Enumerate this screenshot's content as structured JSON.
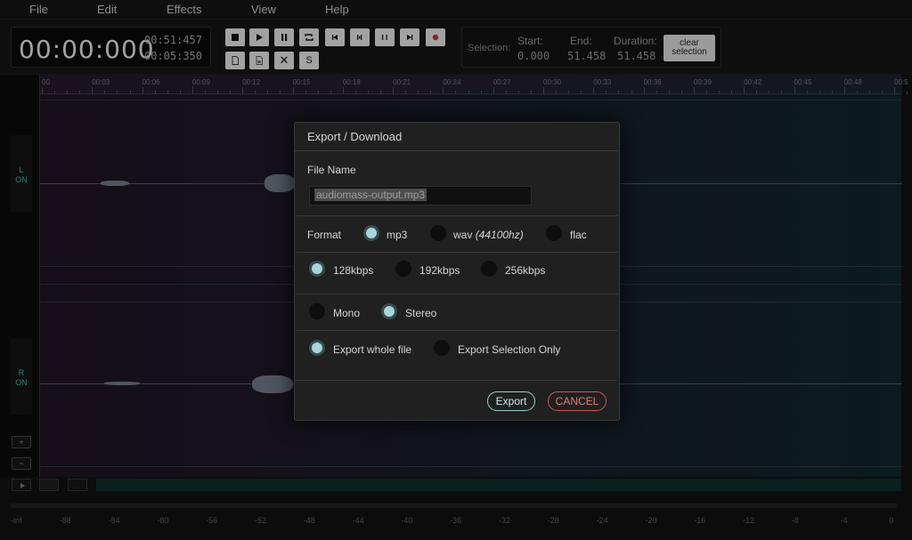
{
  "menu": {
    "file": "File",
    "edit": "Edit",
    "effects": "Effects",
    "view": "View",
    "help": "Help"
  },
  "time": {
    "main": "00:00:000",
    "total": "00:51:457",
    "sub": "00:05:350"
  },
  "selection": {
    "label": "Selection:",
    "start_label": "Start:",
    "start_value": "0.000",
    "end_label": "End:",
    "end_value": "51.458",
    "duration_label": "Duration:",
    "duration_value": "51.458",
    "clear_line1": "clear",
    "clear_line2": "selection"
  },
  "toolbar_extra": {
    "cut_glyph": "✕",
    "s_glyph": "S"
  },
  "timeline_ticks": [
    "00",
    "00:03",
    "00:06",
    "00:09",
    "00:12",
    "00:15",
    "00:18",
    "00:21",
    "00:24",
    "00:27",
    "00:30",
    "00:33",
    "00:36",
    "00:39",
    "00:42",
    "00:45",
    "00:48",
    "00:5"
  ],
  "channels": {
    "left": {
      "letter": "L",
      "state": "ON"
    },
    "right": {
      "letter": "R",
      "state": "ON"
    }
  },
  "meter_labels": [
    "-inf",
    "-88",
    "-84",
    "-80",
    "-56",
    "-52",
    "-48",
    "-44",
    "-40",
    "-36",
    "-32",
    "-28",
    "-24",
    "-20",
    "-16",
    "-12",
    "-8",
    "-4",
    "0"
  ],
  "dialog": {
    "title": "Export / Download",
    "file_name_label": "File Name",
    "file_name_value": "audiomass-output.mp3",
    "format_label": "Format",
    "formats": {
      "mp3": "mp3",
      "wav": "wav",
      "wav_note": "(44100hz)",
      "flac": "flac"
    },
    "bitrates": {
      "b128": "128kbps",
      "b192": "192kbps",
      "b256": "256kbps"
    },
    "channels": {
      "mono": "Mono",
      "stereo": "Stereo"
    },
    "scope": {
      "whole": "Export whole file",
      "selection_only": "Export Selection Only"
    },
    "export_button": "Export",
    "cancel_button": "CANCEL"
  },
  "colors": {
    "accent_teal": "#a6d6da",
    "cancel_red": "#e37b7b",
    "channel_on": "#4aa9a3"
  }
}
